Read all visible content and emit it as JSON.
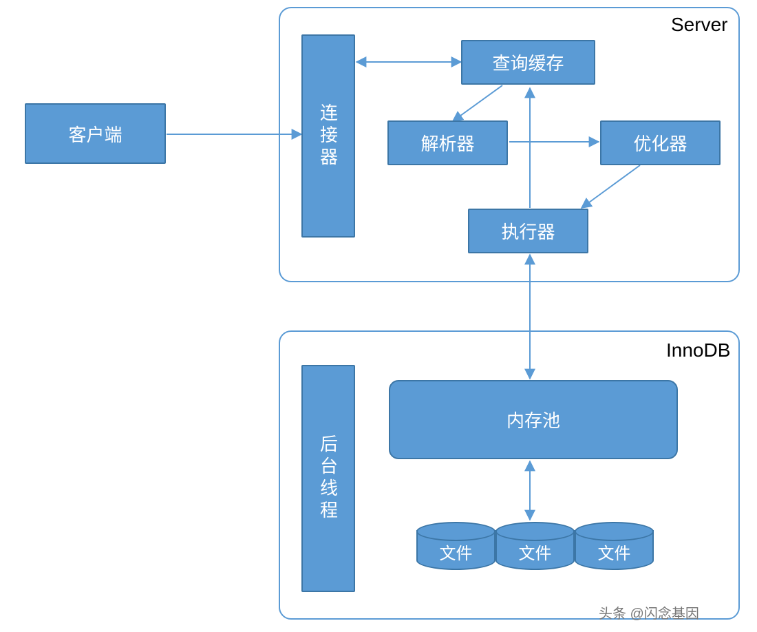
{
  "colors": {
    "fill": "#5b9bd5",
    "stroke": "#3c76a6",
    "frame": "#5b9bd5"
  },
  "nodes": {
    "client": {
      "label": "客户端"
    },
    "connector": {
      "label": "连接器"
    },
    "query_cache": {
      "label": "查询缓存"
    },
    "parser": {
      "label": "解析器"
    },
    "optimizer": {
      "label": "优化器"
    },
    "executor": {
      "label": "执行器"
    },
    "bg_thread": {
      "label": "后台线程"
    },
    "mem_pool": {
      "label": "内存池"
    },
    "file1": {
      "label": "文件"
    },
    "file2": {
      "label": "文件"
    },
    "file3": {
      "label": "文件"
    }
  },
  "frames": {
    "server": {
      "label": "Server"
    },
    "innodb": {
      "label": "InnoDB"
    }
  },
  "watermark": "头条 @闪念基因"
}
